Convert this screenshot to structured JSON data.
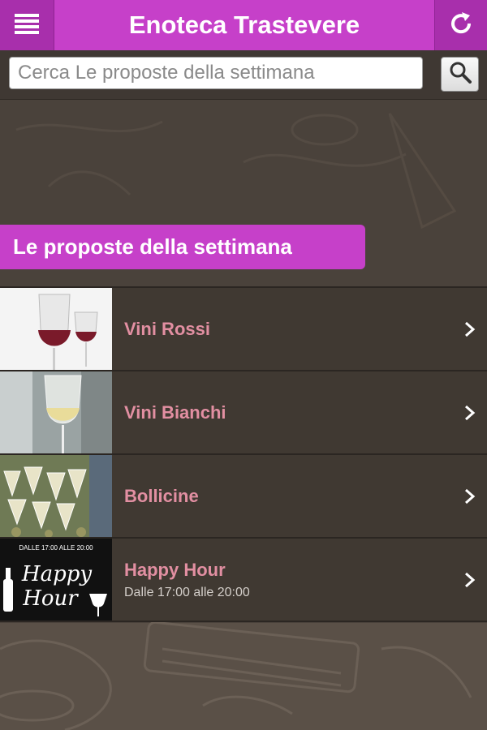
{
  "header": {
    "title": "Enoteca Trastevere",
    "menu_icon": "hamburger-menu-icon",
    "refresh_icon": "refresh-icon"
  },
  "search": {
    "placeholder": "Cerca Le proposte della settimana",
    "button_icon": "search-icon"
  },
  "section": {
    "title": "Le proposte della settimana"
  },
  "items": [
    {
      "label": "Vini Rossi",
      "subtitle": ""
    },
    {
      "label": "Vini Bianchi",
      "subtitle": ""
    },
    {
      "label": "Bollicine",
      "subtitle": ""
    },
    {
      "label": "Happy Hour",
      "subtitle": "Dalle 17:00 alle 20:00"
    }
  ],
  "thumbnails": {
    "happy_hour_top": "DALLE 17:00 ALLE 20:00",
    "happy_hour_script_1": "Happy",
    "happy_hour_script_2": "Hour"
  },
  "colors": {
    "accent": "#c640c9",
    "item_label": "#e28fa2",
    "background": "#4a423b"
  }
}
